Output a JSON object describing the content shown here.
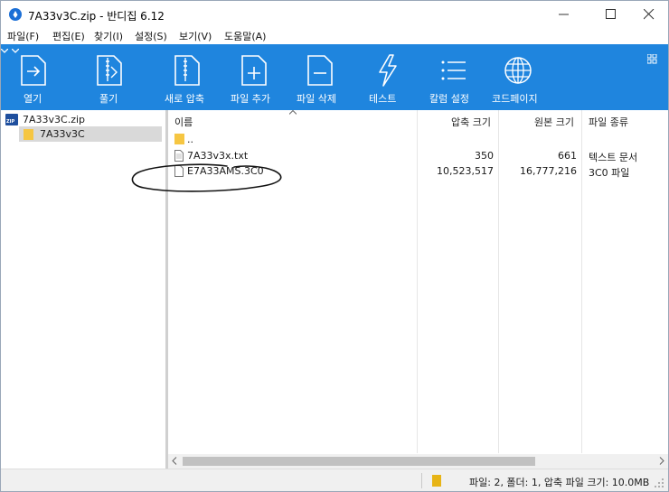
{
  "window": {
    "title": "7A33v3C.zip - 반디집 6.12"
  },
  "menu": [
    "파일(F)",
    "편집(E)",
    "찾기(I)",
    "설정(S)",
    "보기(V)",
    "도움말(A)"
  ],
  "toolbar": {
    "open": "열기",
    "extract": "풀기",
    "new_archive": "새로 압축",
    "add_file": "파일 추가",
    "delete_file": "파일 삭제",
    "test": "테스트",
    "column_settings": "칼럼 설정",
    "codepage": "코드페이지"
  },
  "tree": {
    "root": "7A33v3C.zip",
    "child": "7A33v3C"
  },
  "columns": {
    "name": "이름",
    "compressed": "압축 크기",
    "original": "원본 크기",
    "type": "파일 종류"
  },
  "files": [
    {
      "name": "..",
      "compressed": "",
      "original": "",
      "type": ""
    },
    {
      "name": "7A33v3x.txt",
      "compressed": "350",
      "original": "661",
      "type": "텍스트 문서"
    },
    {
      "name": "E7A33AMS.3C0",
      "compressed": "10,523,517",
      "original": "16,777,216",
      "type": "3C0 파일"
    }
  ],
  "status": {
    "summary": "파일: 2, 폴더: 1, 압축 파일 크기: 10.0MB"
  },
  "colors": {
    "toolbar": "#1f85de",
    "selection": "#d9d9d9",
    "folder": "#f6c642"
  }
}
